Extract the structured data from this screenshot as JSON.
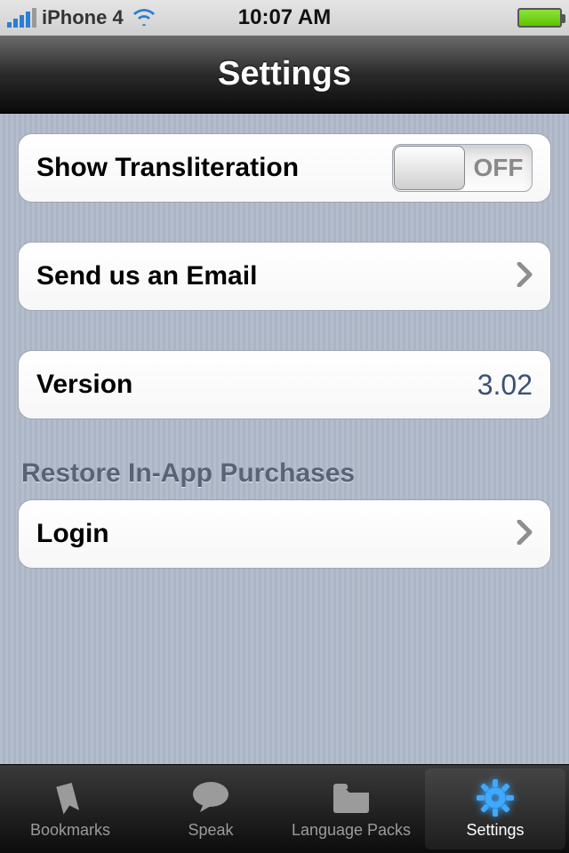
{
  "status": {
    "carrier": "iPhone 4",
    "time": "10:07 AM"
  },
  "nav": {
    "title": "Settings"
  },
  "settings": {
    "transliteration_label": "Show Transliteration",
    "toggle_state": "OFF",
    "email_label": "Send us an Email",
    "version_label": "Version",
    "version_value": "3.02",
    "restore_header": "Restore In-App Purchases",
    "login_label": "Login"
  },
  "tabs": {
    "bookmarks": "Bookmarks",
    "speak": "Speak",
    "language_packs": "Language Packs",
    "settings": "Settings"
  }
}
